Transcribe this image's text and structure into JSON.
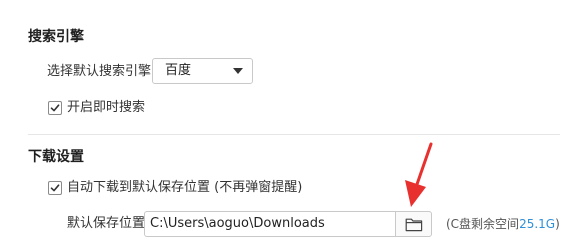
{
  "search_engine": {
    "title": "搜索引擎",
    "select_label": "选择默认搜索引擎",
    "selected_value": "百度",
    "instant_search_label": "开启即时搜索",
    "instant_search_checked": true
  },
  "download": {
    "title": "下载设置",
    "auto_download_label": "自动下载到默认保存位置 (不再弹窗提醒)",
    "auto_download_checked": true,
    "save_location_label": "默认保存位置",
    "save_path": "C:\\Users\\aoguo\\Downloads",
    "free_space_prefix": "(C盘剩余空间",
    "free_space_value": "25.1G",
    "free_space_suffix": ")"
  },
  "colors": {
    "accent_blue": "#2f8fd8",
    "annotation_arrow": "#e8312f"
  },
  "icons": {
    "dropdown": "caret-down",
    "checkbox": "checkmark",
    "browse": "folder-outline",
    "annotation": "red-arrow"
  }
}
